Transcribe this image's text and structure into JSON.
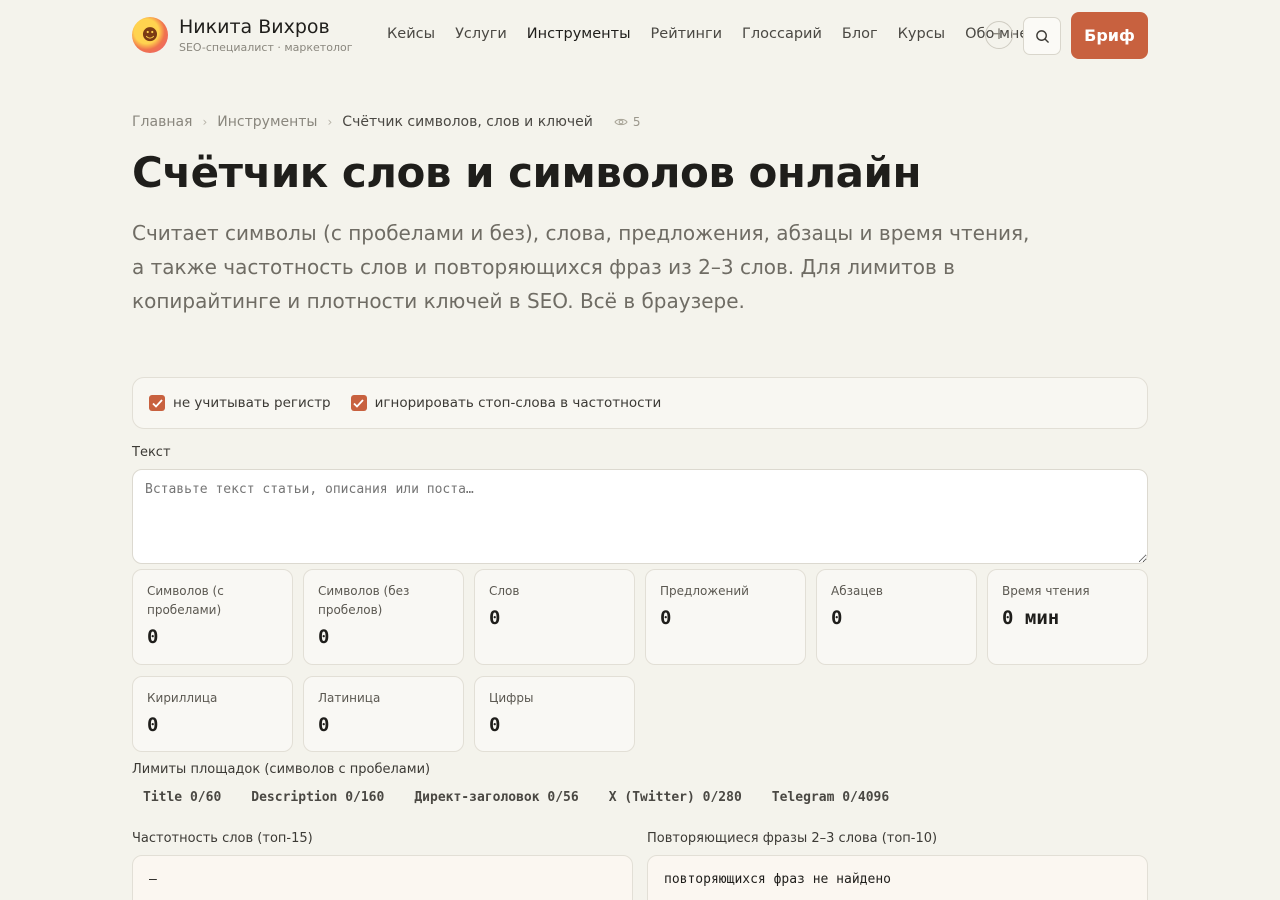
{
  "header": {
    "avatar_icon": "emoji-face-icon",
    "brand_name": "Никита Вихров",
    "brand_subtitle": "SEO-специалист · маркетолог",
    "nav": [
      {
        "label": "Кейсы",
        "active": false
      },
      {
        "label": "Услуги",
        "active": false
      },
      {
        "label": "Инструменты",
        "active": true
      },
      {
        "label": "Рейтинги",
        "active": false
      },
      {
        "label": "Глоссарий",
        "active": false
      },
      {
        "label": "Блог",
        "active": false
      },
      {
        "label": "Курсы",
        "active": false
      },
      {
        "label": "Обо мне",
        "active": false
      }
    ],
    "plus_label": "+",
    "brief_label": "Бриф",
    "accent_color": "#c8613f"
  },
  "breadcrumb": {
    "items": [
      "Главная",
      "Инструменты",
      "Счётчик символов, слов и ключей"
    ],
    "separator": "›",
    "views": "5"
  },
  "page": {
    "title": "Счётчик слов и символов онлайн",
    "lead": "Считает символы (с пробелами и без), слова, предложения, абзацы и время чтения, а также частотность слов и повторяющихся фраз из 2–3 слов. Для лимитов в копирайтинге и плотности ключей в SEO. Всё в браузере."
  },
  "options": [
    {
      "label": "не учитывать регистр",
      "checked": true
    },
    {
      "label": "игнорировать стоп-слова в частотности",
      "checked": true
    }
  ],
  "text_field": {
    "label": "Текст",
    "placeholder": "Вставьте текст статьи, описания или поста…",
    "value": ""
  },
  "stats": [
    {
      "label": "Символов (с пробелами)",
      "value": "0"
    },
    {
      "label": "Символов (без пробелов)",
      "value": "0"
    },
    {
      "label": "Слов",
      "value": "0"
    },
    {
      "label": "Предложений",
      "value": "0"
    },
    {
      "label": "Абзацев",
      "value": "0"
    },
    {
      "label": "Время чтения",
      "value": "0 мин"
    },
    {
      "label": "Кириллица",
      "value": "0"
    },
    {
      "label": "Латиница",
      "value": "0"
    },
    {
      "label": "Цифры",
      "value": "0"
    }
  ],
  "limits": {
    "label": "Лимиты площадок (символов с пробелами)",
    "chips": [
      "Title 0/60",
      "Description 0/160",
      "Директ-заголовок 0/56",
      "X (Twitter) 0/280",
      "Telegram 0/4096"
    ]
  },
  "frequency": {
    "label": "Частотность слов (топ-15)",
    "content": "—"
  },
  "phrases": {
    "label": "Повторяющиеся фразы 2–3 слова (топ-10)",
    "content": "повторяющихся фраз не найдено"
  }
}
